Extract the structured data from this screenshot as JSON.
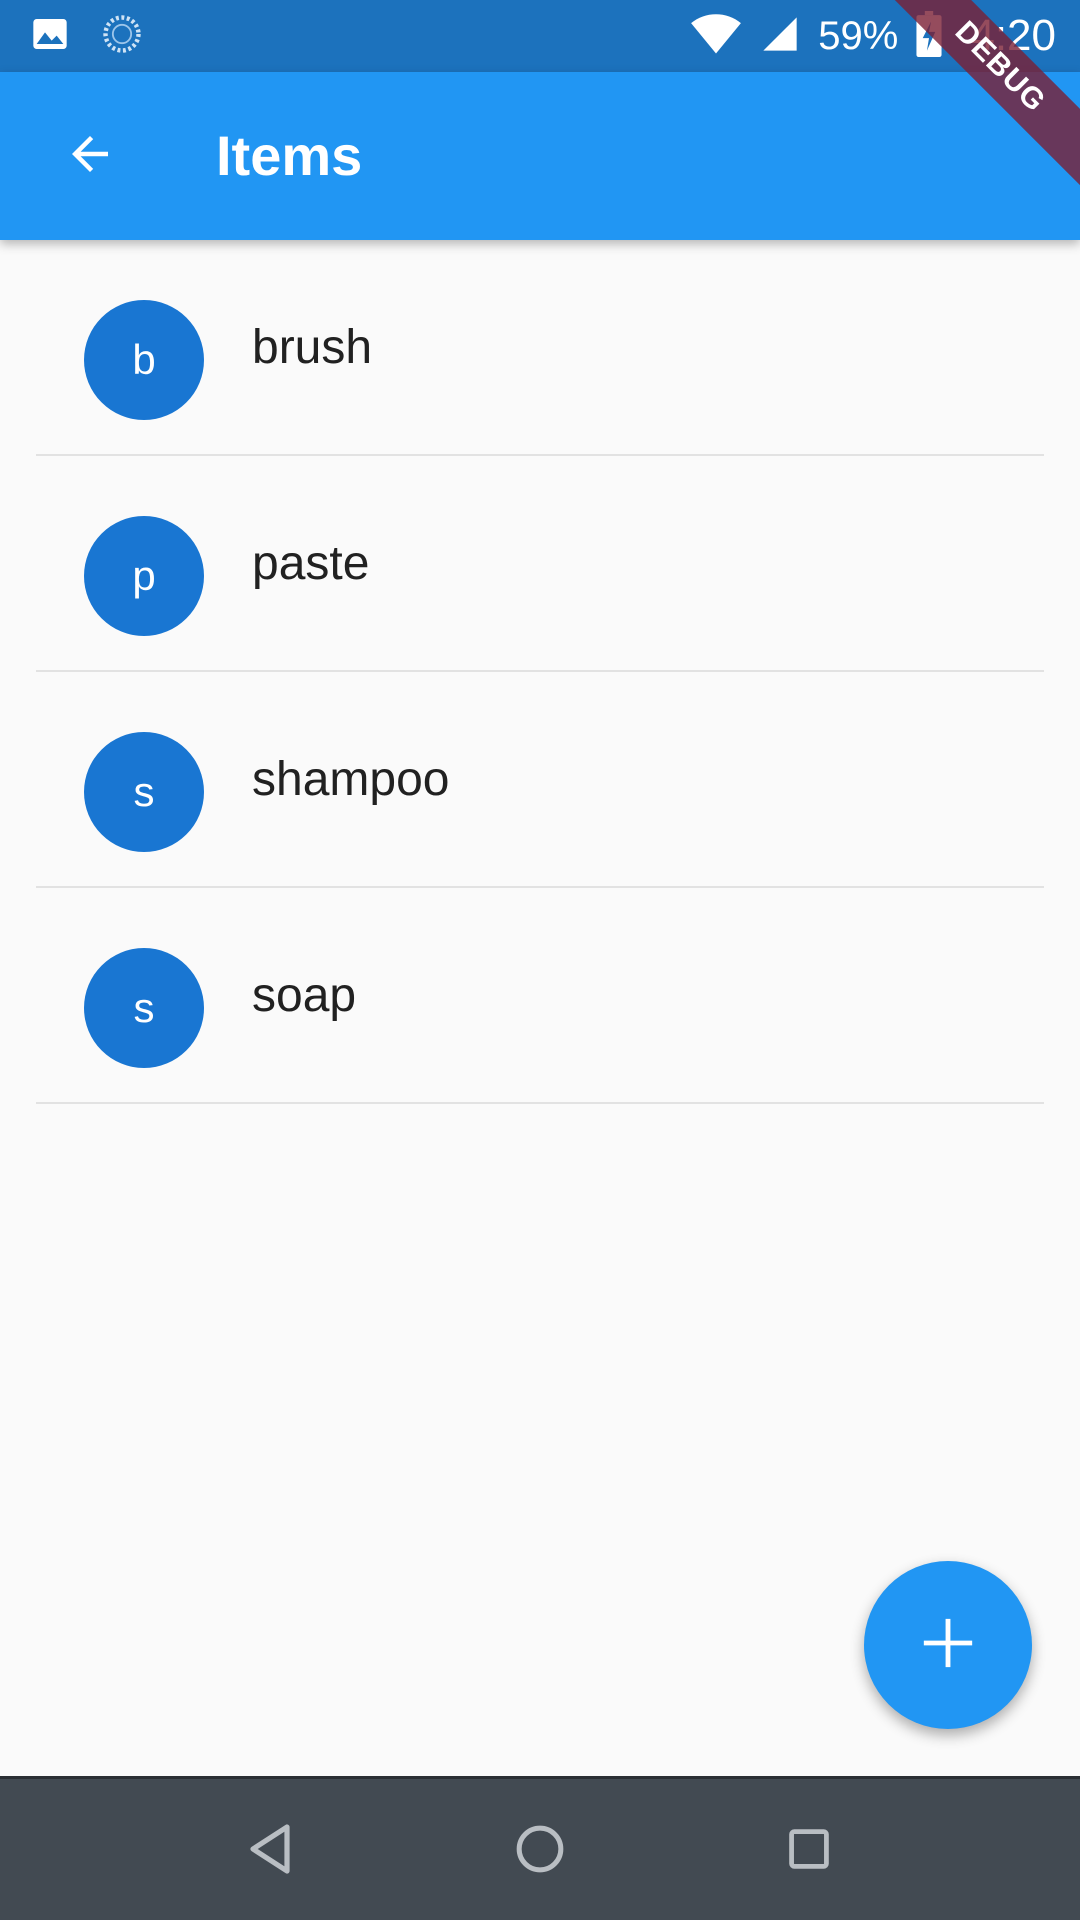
{
  "status_bar": {
    "battery_text": "59%",
    "time": "4:20",
    "icons": [
      "image-icon",
      "sync-icon",
      "wifi-icon",
      "signal-icon",
      "battery-charging-icon"
    ]
  },
  "app_bar": {
    "title": "Items",
    "back_icon": "arrow-back-icon"
  },
  "debug_banner": "DEBUG",
  "items": [
    {
      "initial": "b",
      "label": "brush"
    },
    {
      "initial": "p",
      "label": "paste"
    },
    {
      "initial": "s",
      "label": "shampoo"
    },
    {
      "initial": "s",
      "label": "soap"
    }
  ],
  "fab": {
    "icon": "add-icon"
  },
  "nav_bar": {
    "icons": [
      "nav-back-icon",
      "nav-home-icon",
      "nav-recents-icon"
    ]
  },
  "colors": {
    "status_bar": "#1c72bd",
    "app_bar": "#2196f3",
    "avatar": "#1976d2",
    "fab": "#2196f3",
    "nav_bar": "#424a52",
    "background": "#fafafa"
  }
}
